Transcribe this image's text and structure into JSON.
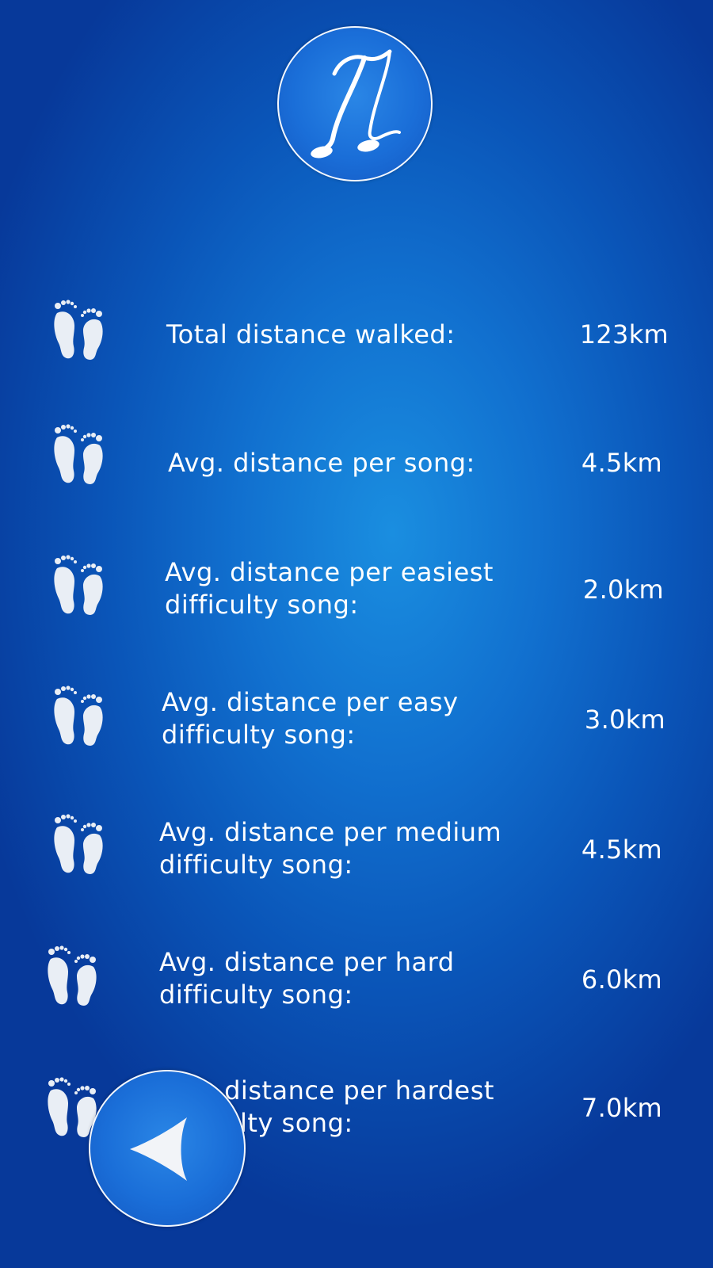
{
  "header": {
    "logo_icon": "music-note-logo-icon"
  },
  "stats": [
    {
      "label": "Total distance walked:",
      "value": "123km",
      "icon": "footprints-icon"
    },
    {
      "label": "Avg. distance per song:",
      "value": "4.5km",
      "icon": "footprints-icon"
    },
    {
      "label": "Avg. distance per easiest\ndifficulty song:",
      "value": "2.0km",
      "icon": "footprints-icon"
    },
    {
      "label": "Avg. distance per easy\ndifficulty song:",
      "value": "3.0km",
      "icon": "footprints-icon"
    },
    {
      "label": "Avg. distance per medium\ndifficulty song:",
      "value": "4.5km",
      "icon": "footprints-icon"
    },
    {
      "label": "Avg. distance per hard\ndifficulty song:",
      "value": "6.0km",
      "icon": "footprints-icon"
    },
    {
      "label": "Avg. distance per hardest\ndifficulty song:",
      "value": "7.0km",
      "icon": "footprints-icon"
    }
  ],
  "navigation": {
    "back_icon": "back-arrow-icon"
  },
  "colors": {
    "background_center": "#1a8ee0",
    "background_edge": "#07399a",
    "text": "#ffffff"
  }
}
